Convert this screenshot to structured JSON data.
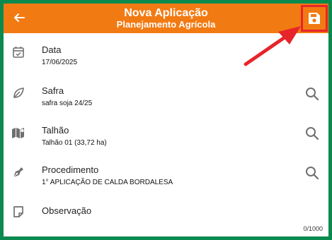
{
  "header": {
    "title": "Nova Aplicação",
    "subtitle": "Planejamento Agrícola",
    "back_icon": "arrow-left-icon",
    "save_icon": "floppy-disk-icon"
  },
  "fields": [
    {
      "label": "Data",
      "value": "17/06/2025",
      "icon": "calendar-check-icon"
    },
    {
      "label": "Safra",
      "value": "safra soja 24/25",
      "icon": "leaf-icon",
      "search": true
    },
    {
      "label": "Talhão",
      "value": "Talhão 01 (33,72 ha)",
      "icon": "map-icon",
      "search": true
    },
    {
      "label": "Procedimento",
      "value": "1° APLICAÇÃO DE CALDA BORDALESA",
      "icon": "pen-nib-icon",
      "search": true
    },
    {
      "label": "Observação",
      "value": "",
      "icon": "sticky-note-icon"
    }
  ],
  "observation_counter": "0/1000",
  "colors": {
    "header": "#f27a12",
    "border": "#0a8a4e",
    "highlight": "#e5252a",
    "icon": "#6f6f6f"
  }
}
